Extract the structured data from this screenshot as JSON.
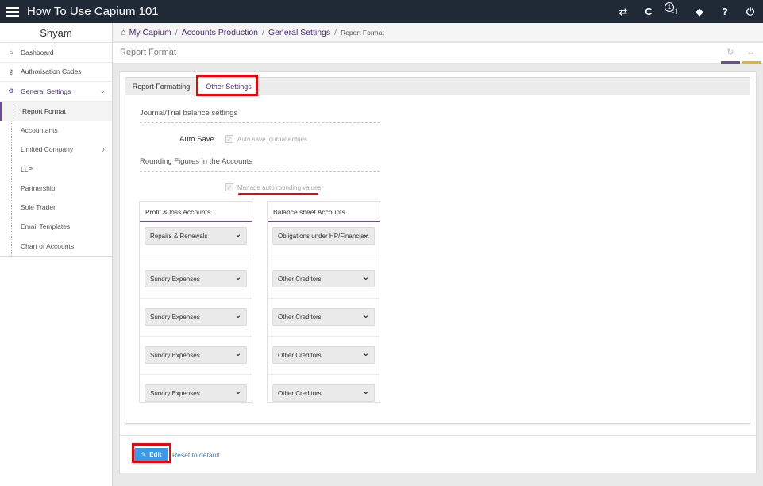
{
  "app": {
    "title": "How To Use Capium 101",
    "notification_count": "1",
    "top_icons": [
      "exchange-icon",
      "capium-logo-icon",
      "megaphone-icon",
      "ticket-icon",
      "help-icon",
      "power-icon"
    ]
  },
  "top_glyphs": {
    "exchange": "⇄",
    "capium": "C",
    "megaphone": "📢",
    "ticket": "◆",
    "help": "?",
    "power": "⏻"
  },
  "sidebar": {
    "user": "Shyam",
    "items": [
      {
        "label": "Dashboard",
        "icon": "home-icon"
      },
      {
        "label": "Authorisation Codes",
        "icon": "key-icon"
      },
      {
        "label": "General Settings",
        "icon": "gears-icon"
      }
    ],
    "sub_items": [
      {
        "label": "Report Format"
      },
      {
        "label": "Accountants"
      },
      {
        "label": "Limited Company"
      },
      {
        "label": "LLP"
      },
      {
        "label": "Partnership"
      },
      {
        "label": "Sole Trader"
      },
      {
        "label": "Email Templates"
      },
      {
        "label": "Chart of Accounts"
      }
    ]
  },
  "breadcrumb": {
    "items": [
      "My Capium",
      "Accounts Production",
      "General Settings"
    ],
    "current": "Report Format"
  },
  "page": {
    "title": "Report Format"
  },
  "tabs": [
    "Report Formatting",
    "Other Settings"
  ],
  "settings": {
    "journal_section": "Journal/Trial balance settings",
    "auto_save_label": "Auto Save",
    "auto_save_checkbox": "Auto save journal entries",
    "rounding_section": "Rounding Figures in the Accounts",
    "manage_rounding": "Manage auto rounding values"
  },
  "accounts": {
    "pl_header": "Profit & loss Accounts",
    "bs_header": "Balance sheet Accounts",
    "pl_values": [
      "Repairs & Renewals",
      "Sundry Expenses",
      "Sundry Expenses",
      "Sundry Expenses",
      "Sundry Expenses"
    ],
    "bs_values": [
      "Obligations under HP/Financia...",
      "Other Creditors",
      "Other Creditors",
      "Other Creditors",
      "Other Creditors"
    ]
  },
  "footer": {
    "edit": "Edit",
    "reset": "Reset to default"
  },
  "colors": {
    "topbar": "#1f2a36",
    "accent_purple": "#6b4c9a",
    "accent_yellow": "#e8b90c",
    "edit_button": "#3a9ae8",
    "highlight_red": "#e10a0a"
  }
}
